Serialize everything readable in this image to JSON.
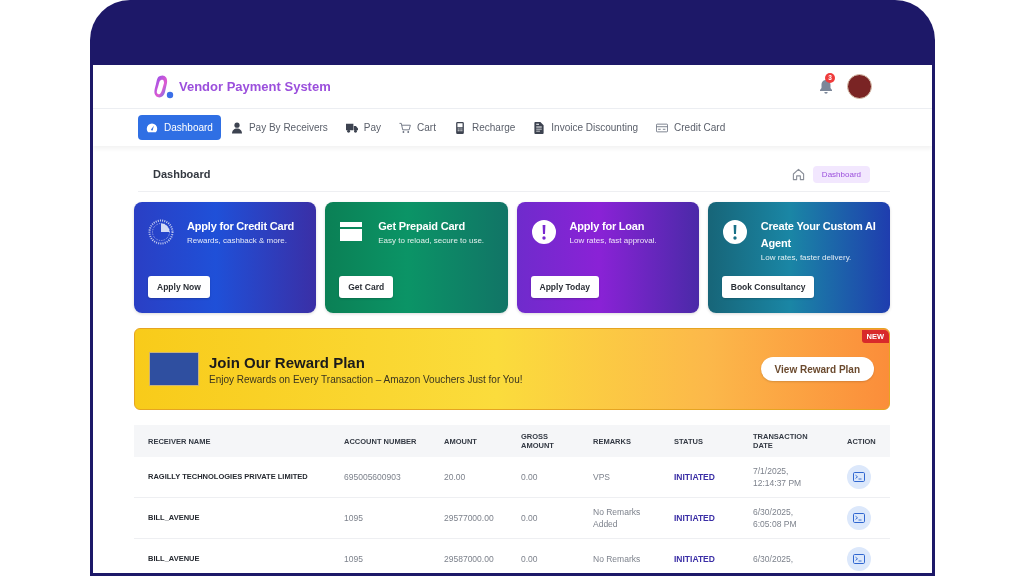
{
  "header": {
    "title": "Vendor Payment System",
    "notifications": "3"
  },
  "nav": [
    {
      "label": "Dashboard",
      "selected": true
    },
    {
      "label": "Pay By Receivers",
      "selected": false
    },
    {
      "label": "Pay",
      "selected": false
    },
    {
      "label": "Cart",
      "selected": false
    },
    {
      "label": "Recharge",
      "selected": false
    },
    {
      "label": "Invoice Discounting",
      "selected": false
    },
    {
      "label": "Credit Card",
      "selected": false
    }
  ],
  "page_title": "Dashboard",
  "breadcrumb": [
    "Dashboard"
  ],
  "cards": [
    {
      "title": "Apply for Credit Card",
      "subtitle": "Rewards, cashback & more.",
      "button": "Apply Now"
    },
    {
      "title": "Get Prepaid Card",
      "subtitle": "Easy to reload, secure to use.",
      "button": "Get Card"
    },
    {
      "title": "Apply for Loan",
      "subtitle": "Low rates, fast approval.",
      "button": "Apply Today"
    },
    {
      "title": "Create Your Custom AI Agent",
      "subtitle": "Low rates, faster delivery.",
      "button": "Book Consultancy"
    }
  ],
  "banner": {
    "title": "Join Our Reward Plan",
    "subtitle": "Enjoy Rewards on Every Transaction – Amazon Vouchers Just for You!",
    "button": "View Reward Plan",
    "badge": "NEW"
  },
  "table": {
    "columns": [
      "RECEIVER NAME",
      "ACCOUNT NUMBER",
      "AMOUNT",
      "GROSS AMOUNT",
      "REMARKS",
      "STATUS",
      "TRANSACTION DATE",
      "ACTION"
    ],
    "rows": [
      {
        "receiver_name": "RAGILLY TECHNOLOGIES PRIVATE LIMITED",
        "account_number": "695005600903",
        "amount": "20.00",
        "gross_amount": "0.00",
        "remarks": "VPS",
        "status": "INITIATED",
        "transaction_date": "7/1/2025, 12:14:37 PM"
      },
      {
        "receiver_name": "BILL_AVENUE",
        "account_number": "1095",
        "amount": "29577000.00",
        "gross_amount": "0.00",
        "remarks": "No Remarks Added",
        "status": "INITIATED",
        "transaction_date": "6/30/2025, 6:05:08 PM"
      },
      {
        "receiver_name": "BILL_AVENUE",
        "account_number": "1095",
        "amount": "29587000.00",
        "gross_amount": "0.00",
        "remarks": "No Remarks",
        "status": "INITIATED",
        "transaction_date": "6/30/2025,"
      }
    ]
  }
}
